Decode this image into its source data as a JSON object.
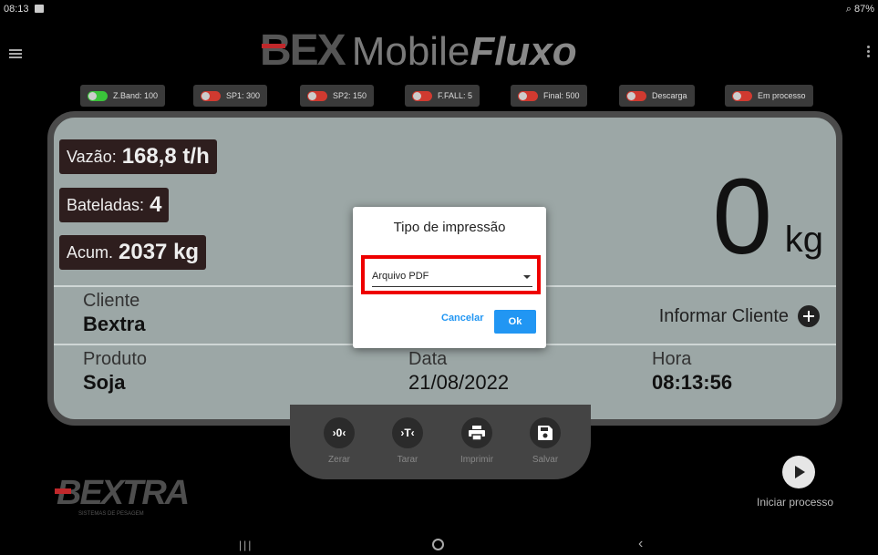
{
  "status_bar": {
    "time": "08:13",
    "battery": "87%"
  },
  "app_logo": {
    "part1": "BEX",
    "part2": "Mobile",
    "part3": "Fluxo"
  },
  "chips": [
    {
      "label": "Z.Band: 100",
      "state": "on"
    },
    {
      "label": "SP1: 300",
      "state": "off"
    },
    {
      "label": "SP2: 150",
      "state": "off"
    },
    {
      "label": "F.FALL: 5",
      "state": "off"
    },
    {
      "label": "Final: 500",
      "state": "off"
    },
    {
      "label": "Descarga",
      "state": "off"
    },
    {
      "label": "Em processo",
      "state": "off"
    }
  ],
  "stats": {
    "vazao_label": "Vazão:",
    "vazao_value": "168,8 t/h",
    "bateladas_label": "Bateladas:",
    "bateladas_value": "4",
    "acum_label": "Acum.",
    "acum_value": "2037 kg"
  },
  "weight": {
    "value": "0",
    "unit": "kg"
  },
  "cliente": {
    "label": "Cliente",
    "value": "Bextra",
    "action": "Informar Cliente"
  },
  "produto": {
    "label": "Produto",
    "value": "Soja"
  },
  "data": {
    "label": "Data",
    "value": "21/08/2022"
  },
  "hora": {
    "label": "Hora",
    "value": "08:13:56"
  },
  "toolbar": {
    "zerar_icon": "›0‹",
    "zerar_label": "Zerar",
    "tarar_icon": "›T‹",
    "tarar_label": "Tarar",
    "imprimir_label": "Imprimir",
    "salvar_label": "Salvar"
  },
  "process": {
    "label": "Iniciar processo"
  },
  "brand": {
    "name": "BEXTRA",
    "tagline": "SISTEMAS DE PESAGEM"
  },
  "dialog": {
    "title": "Tipo de impressão",
    "selected": "Arquivo PDF",
    "cancel": "Cancelar",
    "ok": "Ok"
  }
}
